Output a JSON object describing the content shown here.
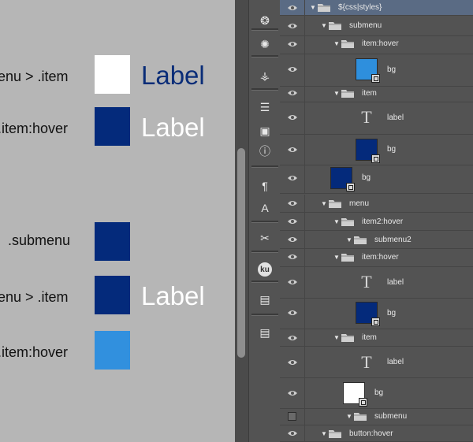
{
  "canvas": {
    "labels": [
      {
        "text": "enu > .item"
      },
      {
        "text": ".item:hover"
      },
      {
        "text": ".submenu"
      },
      {
        "text": "enu > .item"
      },
      {
        "text": ".item:hover"
      }
    ],
    "swatch_colors": [
      "#ffffff",
      "#042a7b",
      "#042a7b",
      "#042a7b",
      "#3190de"
    ],
    "big_labels": [
      {
        "text": "Label",
        "color": "#0a2d78"
      },
      {
        "text": "Label",
        "color": "#ffffff"
      },
      {
        "text": "Label",
        "color": "#ffffff"
      }
    ]
  },
  "tools": [
    {
      "name": "compass-icon",
      "glyph": "❂"
    },
    {
      "name": "sparkle-icon",
      "glyph": "✺"
    },
    {
      "name": "brush-icon",
      "glyph": "⚶"
    },
    {
      "name": "sliders-icon",
      "glyph": "☰"
    },
    {
      "name": "cubes-icon",
      "glyph": "▣"
    },
    {
      "name": "info-icon",
      "glyph": "ⓘ"
    },
    {
      "name": "paragraph-icon",
      "glyph": "¶"
    },
    {
      "name": "character-icon",
      "glyph": "A"
    },
    {
      "name": "tools-icon",
      "glyph": "✂"
    },
    {
      "name": "kuler-icon",
      "glyph": "ku"
    },
    {
      "name": "layer-comps-icon",
      "glyph": "▤"
    },
    {
      "name": "layer-comps-2-icon",
      "glyph": "▤"
    }
  ],
  "layers": [
    {
      "name": "${css|styles}",
      "kind": "folder",
      "expanded": true
    },
    {
      "name": "submenu",
      "kind": "folder",
      "expanded": true
    },
    {
      "name": "item:hover",
      "kind": "folder",
      "expanded": true
    },
    {
      "name": "bg",
      "kind": "shape",
      "color": "#2e8fdd"
    },
    {
      "name": "item",
      "kind": "folder",
      "expanded": true
    },
    {
      "name": "label",
      "kind": "text"
    },
    {
      "name": "bg",
      "kind": "shape",
      "color": "#042a7b"
    },
    {
      "name": "bg",
      "kind": "shape",
      "color": "#042a7b"
    },
    {
      "name": "menu",
      "kind": "folder",
      "expanded": true
    },
    {
      "name": "item2:hover",
      "kind": "folder",
      "expanded": true
    },
    {
      "name": "submenu2",
      "kind": "folder",
      "expanded": true
    },
    {
      "name": "item:hover",
      "kind": "folder",
      "expanded": true
    },
    {
      "name": "label",
      "kind": "text"
    },
    {
      "name": "bg",
      "kind": "shape",
      "color": "#042a7b"
    },
    {
      "name": "item",
      "kind": "folder",
      "expanded": true
    },
    {
      "name": "label",
      "kind": "text"
    },
    {
      "name": "bg",
      "kind": "shape",
      "color": "#ffffff"
    },
    {
      "name": "submenu",
      "kind": "folder",
      "expanded": true,
      "hidden": true
    },
    {
      "name": "button:hover",
      "kind": "folder",
      "expanded": true
    }
  ]
}
